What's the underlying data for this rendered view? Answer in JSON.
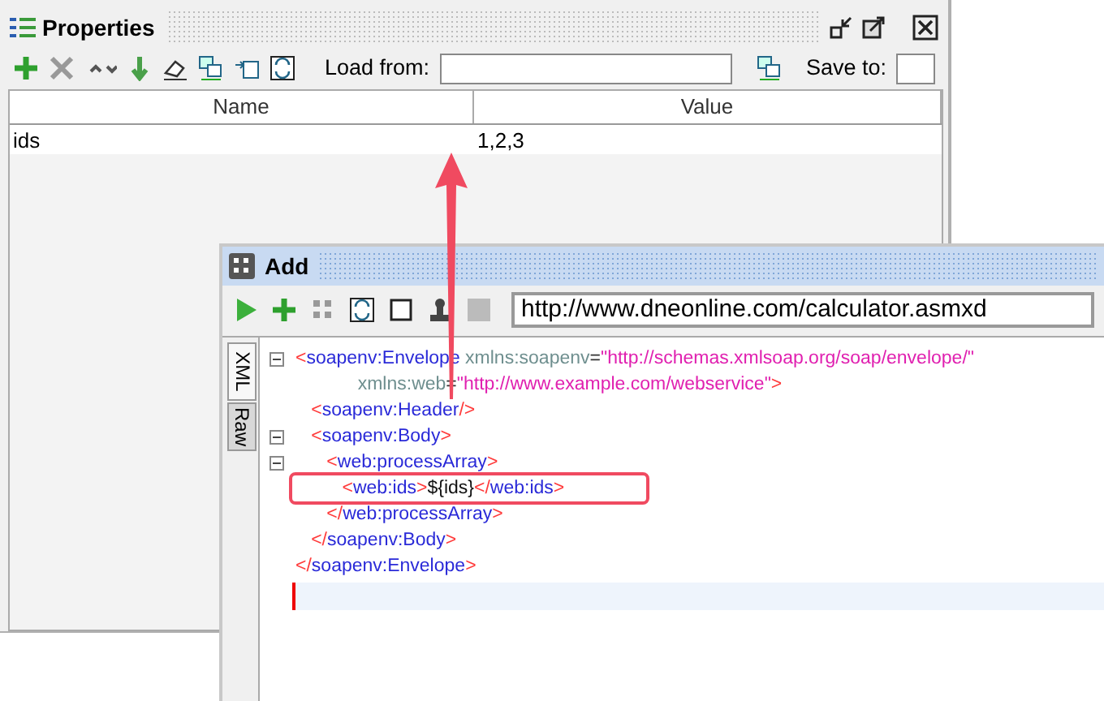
{
  "properties": {
    "title": "Properties",
    "load_label": "Load from:",
    "save_label": "Save to:",
    "columns": [
      "Name",
      "Value"
    ],
    "rows": [
      {
        "name": "ids",
        "value": "1,2,3"
      }
    ]
  },
  "add_window": {
    "title": "Add",
    "url": "http://www.dneonline.com/calculator.asmxd",
    "tabs": [
      {
        "label": "XML",
        "selected": true
      },
      {
        "label": "Raw",
        "selected": false
      }
    ],
    "lines": [
      {
        "foldable": true,
        "highlighted": false,
        "tokens": [
          {
            "kind": "bracket",
            "text": "<"
          },
          {
            "kind": "tag",
            "text": "soapenv:Envelope "
          },
          {
            "kind": "attr",
            "text": "xmlns:soapenv"
          },
          {
            "kind": "eq",
            "text": "="
          },
          {
            "kind": "value",
            "text": "\"http://schemas.xmlsoap.org/soap/envelope/\""
          }
        ]
      },
      {
        "foldable": false,
        "highlighted": false,
        "tokens": [
          {
            "kind": "attr",
            "text": "            xmlns:web"
          },
          {
            "kind": "eq",
            "text": "="
          },
          {
            "kind": "value",
            "text": "\"http://www.example.com/webservice\""
          },
          {
            "kind": "bracket",
            "text": ">"
          }
        ]
      },
      {
        "foldable": false,
        "highlighted": false,
        "tokens": [
          {
            "kind": "bracket",
            "text": "   <"
          },
          {
            "kind": "tag",
            "text": "soapenv:Header"
          },
          {
            "kind": "bracket",
            "text": "/>"
          }
        ]
      },
      {
        "foldable": true,
        "highlighted": false,
        "tokens": [
          {
            "kind": "bracket",
            "text": "   <"
          },
          {
            "kind": "tag",
            "text": "soapenv:Body"
          },
          {
            "kind": "bracket",
            "text": ">"
          }
        ]
      },
      {
        "foldable": true,
        "highlighted": false,
        "tokens": [
          {
            "kind": "bracket",
            "text": "      <"
          },
          {
            "kind": "tag",
            "text": "web:processArray"
          },
          {
            "kind": "bracket",
            "text": ">"
          }
        ]
      },
      {
        "foldable": false,
        "highlighted": true,
        "tokens": [
          {
            "kind": "bracket",
            "text": "         <"
          },
          {
            "kind": "tag",
            "text": "web:ids"
          },
          {
            "kind": "bracket",
            "text": ">"
          },
          {
            "kind": "text",
            "text": "${ids}"
          },
          {
            "kind": "bracket",
            "text": "</"
          },
          {
            "kind": "tag",
            "text": "web:ids"
          },
          {
            "kind": "bracket",
            "text": ">"
          }
        ]
      },
      {
        "foldable": false,
        "highlighted": false,
        "tokens": [
          {
            "kind": "bracket",
            "text": "      </"
          },
          {
            "kind": "tag",
            "text": "web:processArray"
          },
          {
            "kind": "bracket",
            "text": ">"
          }
        ]
      },
      {
        "foldable": false,
        "highlighted": false,
        "tokens": [
          {
            "kind": "bracket",
            "text": "   </"
          },
          {
            "kind": "tag",
            "text": "soapenv:Body"
          },
          {
            "kind": "bracket",
            "text": ">"
          }
        ]
      },
      {
        "foldable": false,
        "highlighted": false,
        "tokens": [
          {
            "kind": "bracket",
            "text": "</"
          },
          {
            "kind": "tag",
            "text": "soapenv:Envelope"
          },
          {
            "kind": "bracket",
            "text": ">"
          }
        ]
      }
    ]
  }
}
